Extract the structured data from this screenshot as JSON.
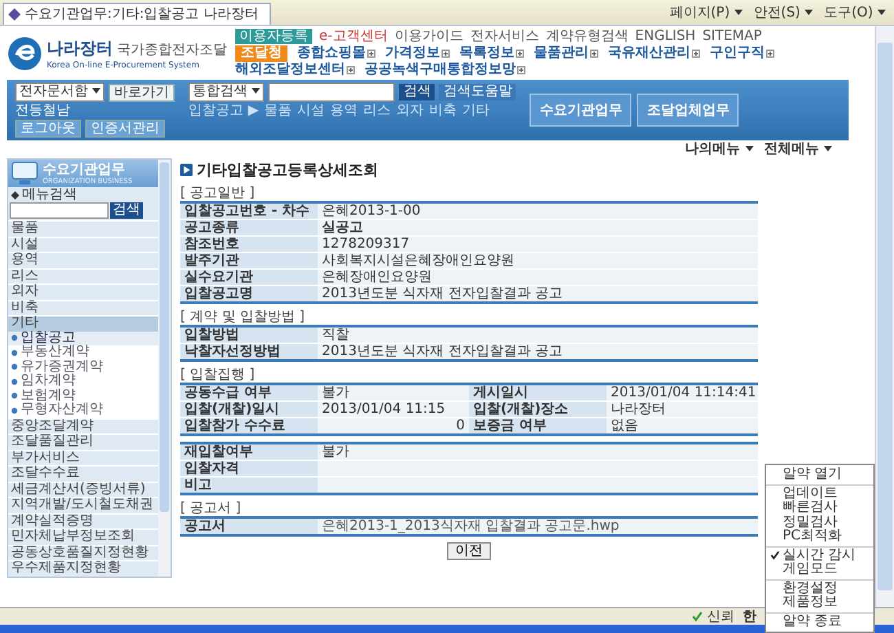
{
  "browser": {
    "tab_title": "수요기관업무:기타:입찰공고 나라장터",
    "tools": [
      "페이지(P)",
      "안전(S)",
      "도구(O)"
    ]
  },
  "header": {
    "logo": {
      "name": "나라장터",
      "sub": "국가종합전자조달",
      "english": "Korea On-line E-Procurement System"
    },
    "top_links": [
      "이용자등록",
      "e-고객센터",
      "이용가이드",
      "전자서비스",
      "계약유형검색",
      "ENGLISH",
      "SITEMAP"
    ],
    "nav": [
      {
        "label": "조달청",
        "selected": true
      },
      {
        "label": "종합쇼핑몰",
        "selected": false
      },
      {
        "label": "가격정보",
        "selected": false
      },
      {
        "label": "목록정보",
        "selected": false
      },
      {
        "label": "물품관리",
        "selected": false
      },
      {
        "label": "국유재산관리",
        "selected": false
      },
      {
        "label": "구인구직",
        "selected": false
      },
      {
        "label": "해외조달정보센터",
        "selected": false
      },
      {
        "label": "공공녹색구매통합정보망",
        "selected": false
      }
    ]
  },
  "search_bar": {
    "doc_select": "전자문서함",
    "go_button": "바로가기",
    "user": "전등철남",
    "account_buttons": [
      "로그아웃",
      "인증서관리"
    ],
    "scope": "통합검색",
    "search_button": "검색",
    "help_button": "검색도움말",
    "quick_label": "입찰공고 ▶",
    "quick_links": [
      "물품",
      "시설",
      "용역",
      "리스",
      "외자",
      "비축",
      "기타"
    ],
    "big_buttons": [
      "수요기관업무",
      "조달업체업무"
    ]
  },
  "menu_links": [
    "나의메뉴",
    "전체메뉴"
  ],
  "sidebar": {
    "title": "수요기관업무",
    "subtitle": "ORGANIZATION BUSINESS",
    "search_label": "메뉴검색",
    "search_button": "검색",
    "items": [
      {
        "label": "물품",
        "expanded": false
      },
      {
        "label": "시설",
        "expanded": false
      },
      {
        "label": "용역",
        "expanded": false
      },
      {
        "label": "리스",
        "expanded": false
      },
      {
        "label": "외자",
        "expanded": false
      },
      {
        "label": "비축",
        "expanded": false
      },
      {
        "label": "기타",
        "expanded": true,
        "children": [
          {
            "label": "입찰공고",
            "selected": true
          },
          {
            "label": "부동산계약",
            "selected": false
          },
          {
            "label": "유가증권계약",
            "selected": false
          },
          {
            "label": "임차계약",
            "selected": false
          },
          {
            "label": "보험계약",
            "selected": false
          },
          {
            "label": "무형자산계약",
            "selected": false
          }
        ]
      },
      {
        "label": "중앙조달계약",
        "expanded": false
      },
      {
        "label": "조달품질관리",
        "expanded": false
      },
      {
        "label": "부가서비스",
        "expanded": false
      },
      {
        "label": "조달수수료",
        "expanded": false
      },
      {
        "label": "세금계산서(증빙서류)",
        "expanded": false
      },
      {
        "label": "지역개발/도시철도채권",
        "expanded": false
      },
      {
        "label": "계약실적증명",
        "expanded": false
      },
      {
        "label": "민자체납부정보조회",
        "expanded": false
      },
      {
        "label": "공동상호품질지정현황",
        "expanded": false
      },
      {
        "label": "우수제품지정현황",
        "expanded": false
      }
    ]
  },
  "content": {
    "title": "기타입찰공고등록상세조회",
    "sections": [
      {
        "label": "[ 공고일반 ]",
        "rows": [
          {
            "cells": [
              "입찰공고번호 - 차수",
              "은혜2013-1-00"
            ]
          },
          {
            "cells": [
              "공고종류",
              "실공고"
            ],
            "bold": true
          },
          {
            "cells": [
              "참조번호",
              "1278209317"
            ]
          },
          {
            "cells": [
              "발주기관",
              "사회복지시설은혜장애인요양원"
            ]
          },
          {
            "cells": [
              "실수요기관",
              "은혜장애인요양원"
            ]
          },
          {
            "cells": [
              "입찰공고명",
              "2013년도분 식자재 전자입찰결과 공고"
            ]
          }
        ]
      },
      {
        "label": "[ 계약 및 입찰방법 ]",
        "rows": [
          {
            "cells": [
              "입찰방법",
              "직찰"
            ]
          },
          {
            "cells": [
              "낙찰자선정방법",
              "2013년도분 식자재 전자입찰결과 공고"
            ]
          }
        ]
      },
      {
        "label": "[ 입찰집행 ]",
        "rows": [
          {
            "cells": [
              "공동수급 여부",
              "불가",
              "게시일시",
              "2013/01/04 11:14:41"
            ]
          },
          {
            "cells": [
              "입찰(개찰)일시",
              "2013/01/04 11:15",
              "입찰(개찰)장소",
              "나라장터"
            ]
          },
          {
            "cells": [
              "입찰참가 수수료",
              "0",
              "보증금 여부",
              "없음"
            ]
          }
        ]
      },
      {
        "rows": [
          {
            "cells": [
              "재입찰여부",
              "불가"
            ]
          },
          {
            "cells": [
              "입찰자격"
            ]
          },
          {
            "cells": [
              "비고"
            ]
          }
        ]
      },
      {
        "label": "[ 공고서 ]",
        "rows": [
          {
            "cells": [
              "공고서",
              "은혜2013-1_2013식자재 입찰결과 공고문.hwp"
            ],
            "link": true
          }
        ]
      }
    ],
    "back_button": "이전"
  },
  "status_bar": {
    "zone": "신뢰",
    "ime": "한"
  },
  "context_menu": {
    "groups": [
      [
        {
          "label": "알약 열기",
          "checked": false
        }
      ],
      [
        {
          "label": "업데이트",
          "checked": false
        },
        {
          "label": "빠른검사",
          "checked": false
        },
        {
          "label": "정밀검사",
          "checked": false
        },
        {
          "label": "PC최적화",
          "checked": false
        }
      ],
      [
        {
          "label": "실시간 감시",
          "checked": true
        },
        {
          "label": "게임모드",
          "checked": false
        }
      ],
      [
        {
          "label": "환경설정",
          "checked": false
        },
        {
          "label": "제품정보",
          "checked": false
        }
      ],
      [
        {
          "label": "알약 종료",
          "checked": false
        }
      ]
    ]
  }
}
